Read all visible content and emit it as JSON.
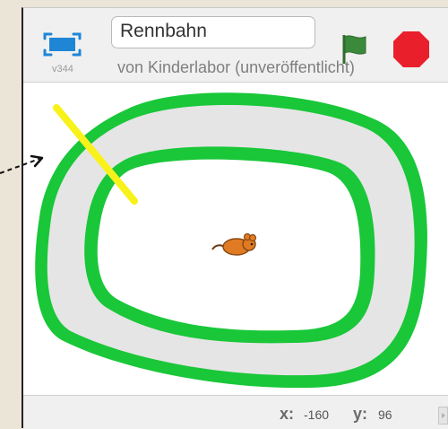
{
  "player": {
    "version": "v344",
    "title_value": "Rennbahn",
    "byline": "von Kinderlabor (unveröffentlicht)"
  },
  "footer": {
    "x_label": "x:",
    "x_value": "-160",
    "y_label": "y:",
    "y_value": "96"
  },
  "colors": {
    "track_border": "#19c738",
    "track_fill": "#e5e5e5",
    "start_line": "#f8f21a",
    "flag": "#3b8a3b",
    "stop": "#e9202c",
    "fullscreen": "#1f86d6"
  },
  "icons": [
    "fullscreen-icon",
    "green-flag-icon",
    "stop-icon",
    "mouse-sprite",
    "dashed-arrow-icon",
    "scroll-right-icon"
  ]
}
